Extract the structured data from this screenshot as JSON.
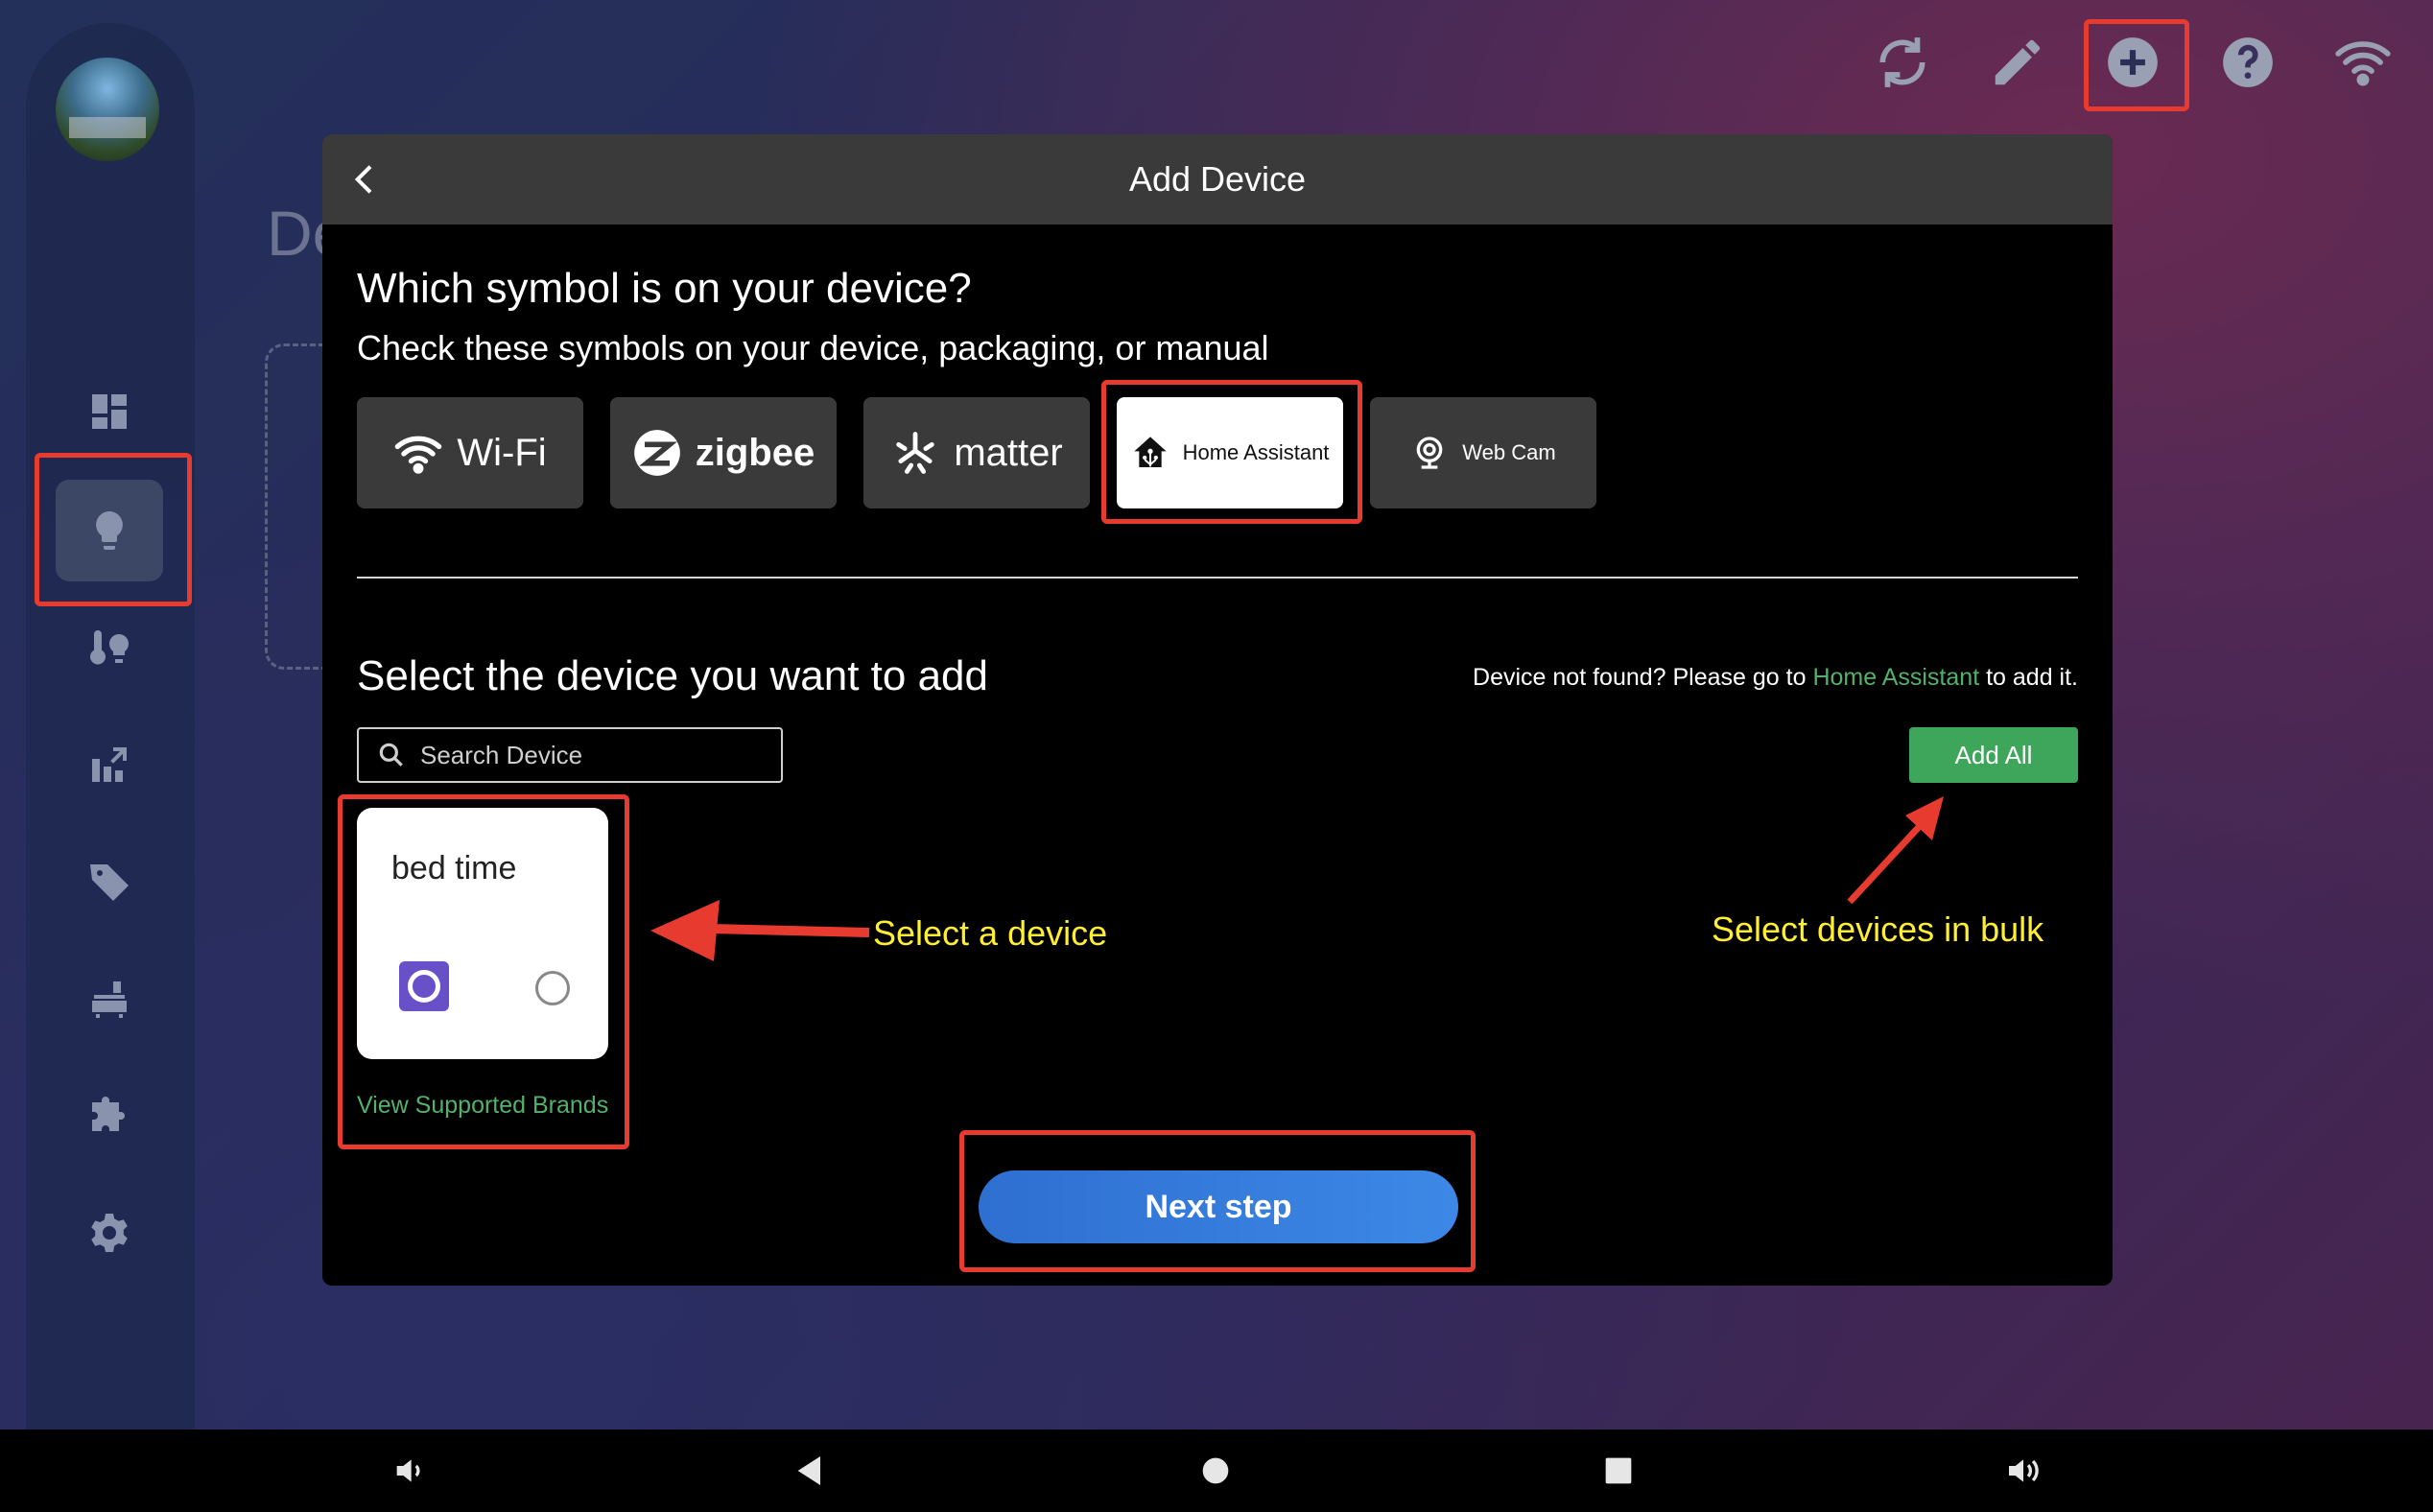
{
  "background_page": {
    "partial_title": "De"
  },
  "modal": {
    "title": "Add Device",
    "question": "Which symbol is on your device?",
    "subtitle": "Check these symbols on your device, packaging, or manual",
    "protocols": [
      {
        "label": "Wi-Fi",
        "icon": "wifi-icon",
        "selected": false
      },
      {
        "label": "zigbee",
        "icon": "zigbee-icon",
        "selected": false
      },
      {
        "label": "matter",
        "icon": "matter-icon",
        "selected": false
      },
      {
        "label": "Home Assistant",
        "icon": "home-assistant-icon",
        "selected": true
      },
      {
        "label": "Web Cam",
        "icon": "webcam-icon",
        "selected": false
      }
    ],
    "select_title": "Select the device you want to add",
    "not_found_prefix": "Device not found? Please go to ",
    "not_found_link": "Home Assistant",
    "not_found_suffix": " to add it.",
    "search_placeholder": "Search Device",
    "add_all_label": "Add All",
    "device_card": {
      "name": "bed time",
      "selected": false
    },
    "view_brands_label": "View Supported Brands",
    "next_label": "Next step"
  },
  "annotations": {
    "select_device": "Select a device",
    "select_bulk": "Select devices in bulk"
  },
  "colors": {
    "accent_green": "#3ea65a",
    "link_green": "#52b26a",
    "annotation_red": "#e63b2e",
    "annotation_yellow": "#ffee33",
    "next_blue": "#2e6fd0"
  }
}
